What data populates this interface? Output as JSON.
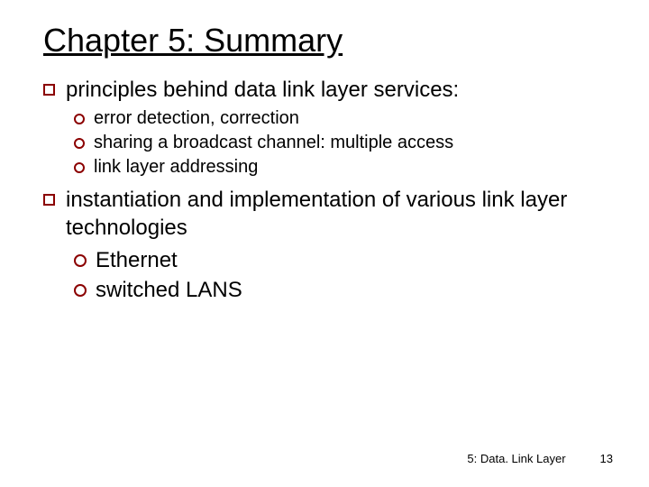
{
  "title": "Chapter 5: Summary",
  "items": [
    {
      "text": "principles behind data link layer services:"
    },
    {
      "text": "error detection, correction"
    },
    {
      "text": "sharing a broadcast channel: multiple access"
    },
    {
      "text": "link layer addressing"
    },
    {
      "text": "instantiation and implementation of various link layer technologies"
    },
    {
      "text": "Ethernet"
    },
    {
      "text": "switched LANS"
    }
  ],
  "footer": {
    "chapter": "5: Data. Link Layer",
    "page": "13"
  }
}
